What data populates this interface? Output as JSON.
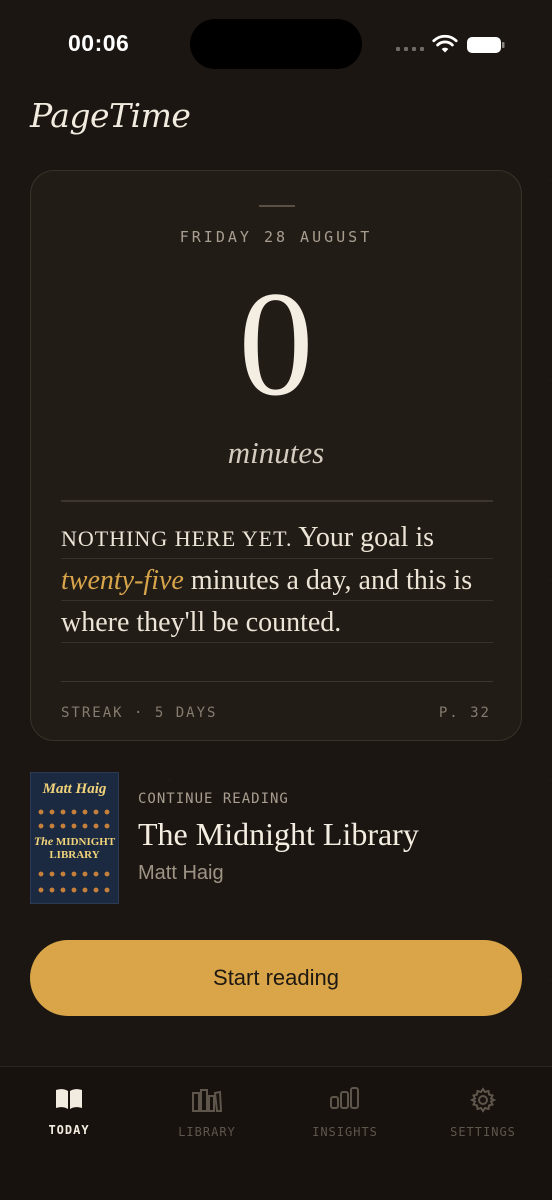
{
  "status_bar": {
    "time": "00:06"
  },
  "app": {
    "brand": "PageTime"
  },
  "today_card": {
    "date": "FRIDAY 28 AUGUST",
    "minutes_value": "0",
    "minutes_unit": "minutes",
    "message_lead": "NOTHING HERE YET.",
    "message_part1": " Your goal is ",
    "message_accent": "twenty-five",
    "message_part2": " minutes a day, and this is where they'll be counted.",
    "streak": "STREAK · 5 DAYS",
    "page": "P. 32"
  },
  "continue_reading": {
    "label": "CONTINUE READING",
    "title": "The Midnight Library",
    "author": "Matt Haig",
    "cover": {
      "author": "Matt Haig",
      "title_prefix": "The",
      "title_line1": "MIDNIGHT",
      "title_line2": "LIBRARY"
    }
  },
  "cta": {
    "label": "Start reading"
  },
  "tab_bar": {
    "tabs": [
      {
        "label": "TODAY",
        "icon": "book-open-icon",
        "active": true
      },
      {
        "label": "LIBRARY",
        "icon": "library-books-icon",
        "active": false
      },
      {
        "label": "INSIGHTS",
        "icon": "bar-chart-icon",
        "active": false
      },
      {
        "label": "SETTINGS",
        "icon": "gear-icon",
        "active": false
      }
    ]
  },
  "colors": {
    "accent": "#d9a548",
    "background": "#1c1612",
    "card": "#221c17"
  }
}
